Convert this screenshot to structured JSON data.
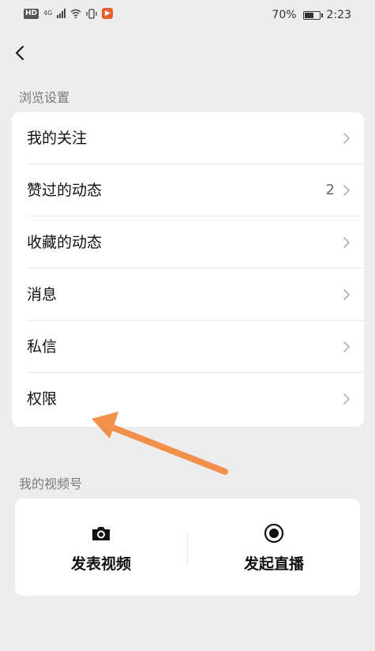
{
  "status_bar": {
    "hd": "HD",
    "network": "4G",
    "app_badge": "▶",
    "battery_text": "70%",
    "battery_level": 0.7,
    "time": "2:23"
  },
  "icons": {
    "back": "chevron-left-icon",
    "chevron": "chevron-right-icon",
    "camera": "camera-icon",
    "live": "record-icon"
  },
  "browse_settings": {
    "title": "浏览设置",
    "items": [
      {
        "label": "我的关注",
        "badge": ""
      },
      {
        "label": "赞过的动态",
        "badge": "2"
      },
      {
        "label": "收藏的动态",
        "badge": ""
      },
      {
        "label": "消息",
        "badge": ""
      },
      {
        "label": "私信",
        "badge": ""
      },
      {
        "label": "权限",
        "badge": ""
      }
    ]
  },
  "channel": {
    "title": "我的视频号",
    "publish_video_label": "发表视频",
    "start_live_label": "发起直播"
  },
  "colors": {
    "background": "#ededed",
    "card": "#ffffff",
    "annotation_arrow": "#f0904a"
  }
}
